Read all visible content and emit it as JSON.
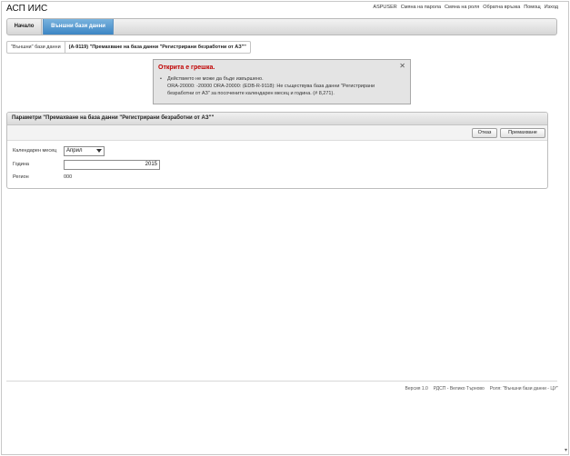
{
  "app": {
    "title": "АСП ИИС"
  },
  "top_links": [
    "ASPUSER",
    "Смяна на парола",
    "Смяна на роля",
    "Обратна връзка",
    "Помощ",
    "Изход"
  ],
  "nav": {
    "home": "Начало",
    "active": "Външни бази данни"
  },
  "breadcrumb": {
    "first": "\"Външни\" бази данни",
    "current": "(А-9119) \"Премахване на база данни \"Регистрирани безработни от АЗ\"\""
  },
  "error": {
    "title": "Открита е грешка.",
    "line1": "Действието не може да бъде извършено.",
    "line2": "ORA-20000: -20000 ORA-20000: (EDB-R-9118): Не съществува база данни \"Регистрирани",
    "line3": "безработни от АЗ\" за посочените календарен месец и година. (# 8,271)."
  },
  "region": {
    "title": "Параметри \"Премахване на база данни \"Регистрирани безработни от АЗ\"\"",
    "cancel_label": "Отказ",
    "delete_label": "Премахване",
    "month_label": "Календарен месец",
    "month_value": "Април",
    "year_label": "Година",
    "year_value": "2015",
    "region_label": "Регион",
    "region_value": "000"
  },
  "footer": {
    "version": "Версия 1.0",
    "unit": "РДСП - Велико Търново",
    "role": "Роля: \"Външни бази данни - ЦУ\""
  }
}
